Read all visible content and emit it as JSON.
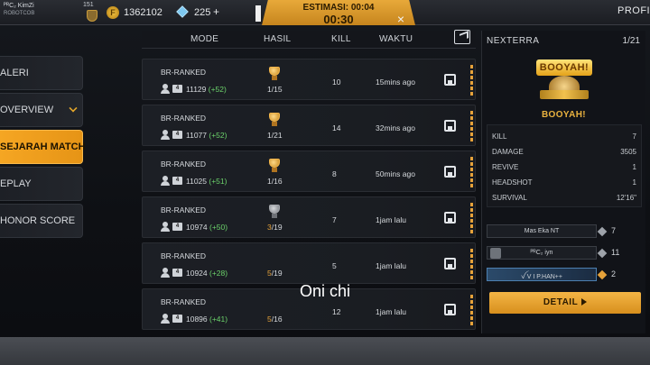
{
  "topbar": {
    "player_name": "ᴾᴿC₂ KimZi",
    "player_sub": "ROBOTCOB",
    "level": "151",
    "gold_value": "1362102",
    "gold_icon": "F",
    "diamond_value": "225",
    "diamond_plus": "+",
    "estimasi_label": "ESTIMASI: 00:04",
    "timer": "00:30",
    "close_icon": "×",
    "profile_label": "PROFI"
  },
  "nav": {
    "items": [
      {
        "label": "ALERI"
      },
      {
        "label": "OVERVIEW"
      },
      {
        "label": "SEJARAH MATCH"
      },
      {
        "label": "EPLAY"
      },
      {
        "label": "HONOR SCORE"
      }
    ]
  },
  "table": {
    "headers": {
      "mode": "MODE",
      "hasil": "HASIL",
      "kill": "KILL",
      "waktu": "WAKTU"
    },
    "rows": [
      {
        "mode": "BR-RANKED",
        "tag": "4",
        "points": "11129",
        "delta": "(+52)",
        "trophy": "gold",
        "rank": "1",
        "of": "/15",
        "rank_color": "white",
        "kill": "10",
        "time": "15mins ago"
      },
      {
        "mode": "BR-RANKED",
        "tag": "4",
        "points": "11077",
        "delta": "(+52)",
        "trophy": "gold",
        "rank": "1",
        "of": "/21",
        "rank_color": "white",
        "kill": "14",
        "time": "32mins ago"
      },
      {
        "mode": "BR-RANKED",
        "tag": "4",
        "points": "11025",
        "delta": "(+51)",
        "trophy": "gold",
        "rank": "1",
        "of": "/16",
        "rank_color": "white",
        "kill": "8",
        "time": "50mins ago"
      },
      {
        "mode": "BR-RANKED",
        "tag": "4",
        "points": "10974",
        "delta": "(+50)",
        "trophy": "silver",
        "rank": "3",
        "of": "/19",
        "rank_color": "orange",
        "kill": "7",
        "time": "1jam lalu"
      },
      {
        "mode": "BR-RANKED",
        "tag": "4",
        "points": "10924",
        "delta": "(+28)",
        "trophy": "none",
        "rank": "5",
        "of": "/19",
        "rank_color": "orange",
        "kill": "5",
        "time": "1jam lalu"
      },
      {
        "mode": "BR-RANKED",
        "tag": "4",
        "points": "10896",
        "delta": "(+41)",
        "trophy": "none",
        "rank": "5",
        "of": "/16",
        "rank_color": "orange",
        "kill": "12",
        "time": "1jam lalu"
      }
    ]
  },
  "detail_panel": {
    "map": "NEXTERRA",
    "count": "1/21",
    "logo_text": "BOOYAH!",
    "result": "BOOYAH!",
    "stats": [
      {
        "label": "KILL",
        "value": "7"
      },
      {
        "label": "DAMAGE",
        "value": "3505"
      },
      {
        "label": "REVIVE",
        "value": "1"
      },
      {
        "label": "HEADSHOT",
        "value": "1"
      },
      {
        "label": "SURVIVAL",
        "value": "12'16\""
      }
    ],
    "teammates": [
      {
        "name": "Mas   Eka   NT",
        "kills": "7",
        "highlight": false
      },
      {
        "name": "ᴾᴿC₂  iyn",
        "kills": "11",
        "highlight": false
      },
      {
        "name": "ꪜ V I P.HAN++",
        "kills": "2",
        "highlight": true
      }
    ],
    "detail_button": "DETAIL"
  },
  "caption": "Oni chi",
  "colors": {
    "accent": "#f5a623",
    "positive": "#6cd36b",
    "rank_orange": "#e6a23a"
  }
}
